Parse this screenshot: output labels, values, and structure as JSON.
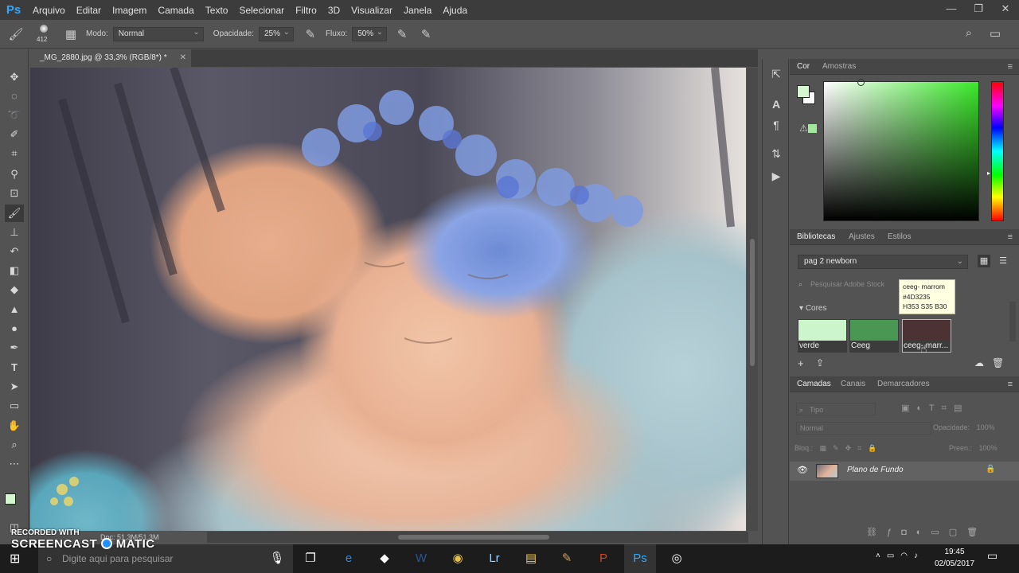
{
  "app": {
    "logo": "Ps",
    "menu": [
      "Arquivo",
      "Editar",
      "Imagem",
      "Camada",
      "Texto",
      "Selecionar",
      "Filtro",
      "3D",
      "Visualizar",
      "Janela",
      "Ajuda"
    ],
    "window_controls": [
      "—",
      "❐",
      "✕"
    ]
  },
  "options_bar": {
    "brush_size": "412",
    "mode_label": "Modo:",
    "mode_value": "Normal",
    "opacity_label": "Opacidade:",
    "opacity_value": "25%",
    "flow_label": "Fluxo:",
    "flow_value": "50%"
  },
  "document": {
    "tab_title": "_MG_2880.jpg @ 33,3% (RGB/8*) *",
    "close_glyph": "✕",
    "status": "Doc: 51,3M/51,3M"
  },
  "color_panel": {
    "tabs": [
      "Cor",
      "Amostras"
    ],
    "hue_colors": [
      "#ff0000",
      "#ff00ff",
      "#0000ff",
      "#00ffff",
      "#00ff00",
      "#ffff00"
    ],
    "base_color": "#3be82a",
    "foreground": "#d5f5d0",
    "background": "#ffffff"
  },
  "libraries_panel": {
    "tabs": [
      "Bibliotecas",
      "Ajustes",
      "Estilos"
    ],
    "library_name": "pag 2 newborn",
    "search_placeholder": "Pesquisar Adobe Stock",
    "section_title": "Cores",
    "swatches": [
      {
        "label": "verde",
        "color": "#cdf5cb"
      },
      {
        "label": "Ceeg",
        "color": "#4a9653"
      },
      {
        "label": "ceeg- marr...",
        "color": "#4d3235"
      }
    ],
    "tooltip": {
      "line1": "ceeg- marrom",
      "line2": "#4D3235",
      "line3": "H353 S35 B30"
    }
  },
  "layers_panel": {
    "tabs": [
      "Camadas",
      "Canais",
      "Demarcadores"
    ],
    "filter_placeholder": "Tipo",
    "blend_mode": "Normal",
    "opacity_label": "Opacidade:",
    "opacity_value": "100%",
    "lock_label": "Bloq.:",
    "fill_label": "Preen.:",
    "fill_value": "100%",
    "layer_name": "Plano de Fundo"
  },
  "taskbar": {
    "search_placeholder": "Digite aqui para pesquisar",
    "time": "19:45",
    "date": "02/05/2017"
  },
  "watermark": {
    "line1": "RECORDED WITH",
    "line2": "SCREENCAST",
    "line3": "MATIC"
  }
}
